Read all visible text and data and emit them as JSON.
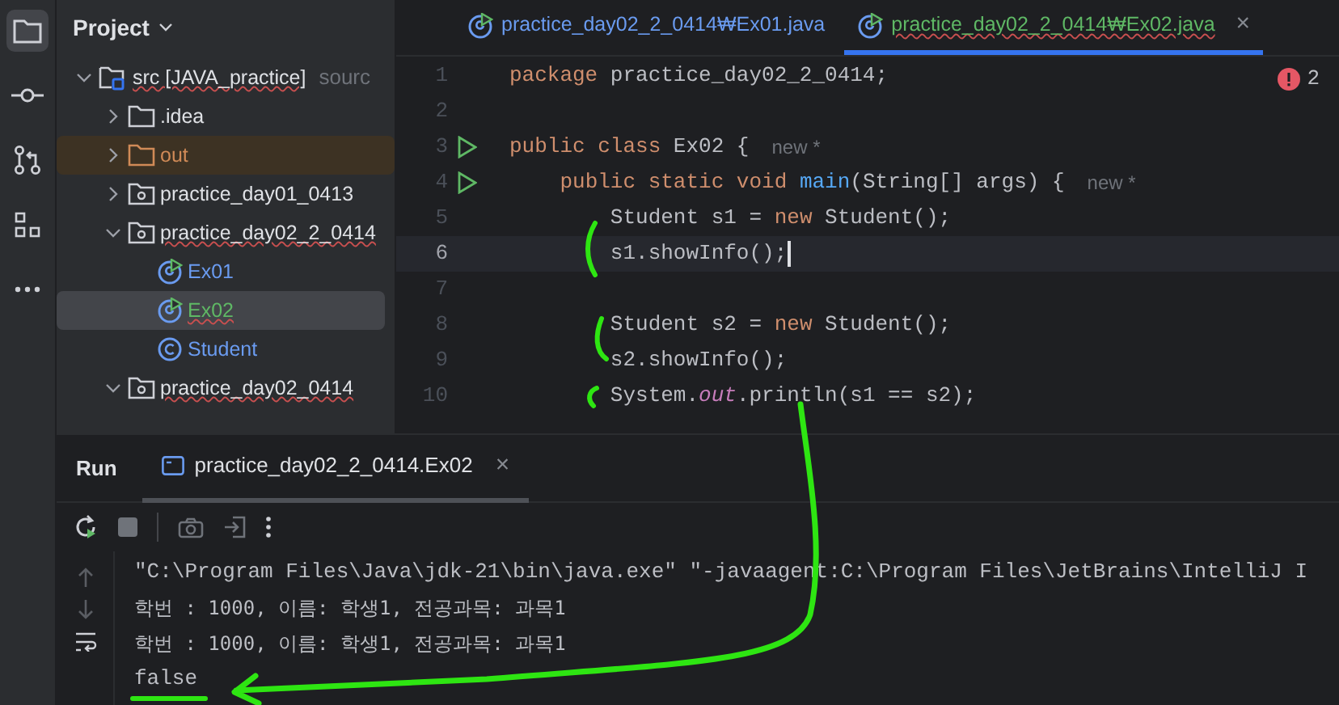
{
  "project": {
    "title": "Project",
    "tree": [
      {
        "label": "src [JAVA_practice]",
        "hint": "sourc",
        "kind": "source",
        "expanded": true,
        "selected": false,
        "children": [
          {
            "label": ".idea",
            "kind": "folder",
            "expanded": false,
            "selected": false,
            "excluded": false
          },
          {
            "label": "out",
            "kind": "folder",
            "expanded": false,
            "selected": false,
            "excluded": true
          },
          {
            "label": "practice_day01_0413",
            "kind": "package",
            "expanded": false,
            "selected": false
          },
          {
            "label": "practice_day02_2_0414",
            "kind": "package",
            "expanded": true,
            "selected": false,
            "children": [
              {
                "label": "Ex01",
                "kind": "runnable",
                "selected": false
              },
              {
                "label": "Ex02",
                "kind": "runnable",
                "selected": true
              },
              {
                "label": "Student",
                "kind": "class",
                "selected": false
              }
            ]
          },
          {
            "label": "practice_day02_0414",
            "kind": "package",
            "expanded": true,
            "selected": false
          }
        ]
      }
    ]
  },
  "editor_tabs": [
    {
      "label": "practice_day02_2_0414₩Ex01.java",
      "selected": false
    },
    {
      "label": "practice_day02_2_0414₩Ex02.java",
      "selected": true,
      "close": "×"
    }
  ],
  "problems": {
    "count": "2"
  },
  "code": [
    {
      "number": "1",
      "run": false,
      "current": false,
      "tokens": [
        {
          "t": "package",
          "kind": "keyword"
        },
        {
          "t": " practice_day02_2_0414;",
          "kind": "plain"
        }
      ]
    },
    {
      "number": "2",
      "run": false,
      "current": false
    },
    {
      "number": "3",
      "run": true,
      "current": false,
      "hint": "new *",
      "tokens": [
        {
          "t": "public class",
          "kind": "keyword"
        },
        {
          "t": " Ex02 {",
          "kind": "plain"
        }
      ]
    },
    {
      "number": "4",
      "run": true,
      "current": false,
      "hint": "new *",
      "tokens": [
        {
          "t": "    public static void",
          "kind": "keyword"
        },
        {
          "t": " main",
          "kind": "method"
        },
        {
          "t": "(String[] args) {",
          "kind": "plain"
        }
      ]
    },
    {
      "number": "5",
      "run": false,
      "current": false,
      "tokens": [
        {
          "t": "        Student s1 = ",
          "kind": "plain"
        },
        {
          "t": "new",
          "kind": "keyword"
        },
        {
          "t": " Student();",
          "kind": "plain"
        }
      ]
    },
    {
      "number": "6",
      "run": false,
      "current": true,
      "tokens": [
        {
          "t": "        s1.showInfo();",
          "kind": "plain"
        }
      ]
    },
    {
      "number": "7",
      "run": false,
      "current": false
    },
    {
      "number": "8",
      "run": false,
      "current": false,
      "tokens": [
        {
          "t": "        Student s2 = ",
          "kind": "plain"
        },
        {
          "t": "new",
          "kind": "keyword"
        },
        {
          "t": " Student();",
          "kind": "plain"
        }
      ]
    },
    {
      "number": "9",
      "run": false,
      "current": false,
      "tokens": [
        {
          "t": "        s2.showInfo();",
          "kind": "plain"
        }
      ]
    },
    {
      "number": "10",
      "run": false,
      "current": false,
      "tokens": [
        {
          "t": "        System.",
          "kind": "plain"
        },
        {
          "t": "out",
          "kind": "field"
        },
        {
          "t": ".println(s1 == s2);",
          "kind": "plain"
        }
      ]
    }
  ],
  "run_panel": {
    "title": "Run",
    "tabs": [
      {
        "label": "practice_day02_2_0414.Ex02",
        "selected": true,
        "close": "×"
      }
    ],
    "console": [
      "\"C:\\Program Files\\Java\\jdk-21\\bin\\java.exe\" \"-javaagent:C:\\Program Files\\JetBrains\\IntelliJ I",
      "학번 : 1000, 이름: 학생1, 전공과목: 과목1",
      "학번 : 1000, 이름: 학생1, 전공과목: 과목1",
      "false"
    ]
  }
}
